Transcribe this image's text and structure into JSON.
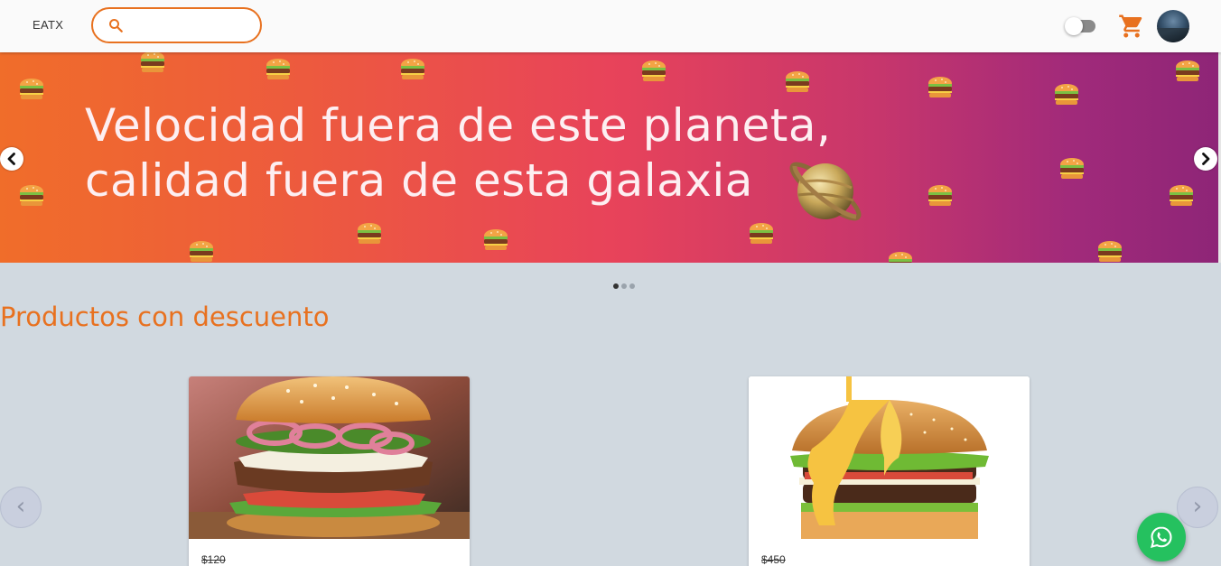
{
  "header": {
    "brand": "EATX",
    "search": {
      "value": "",
      "placeholder": ""
    },
    "dark_mode_toggle": {
      "on": false
    }
  },
  "banner": {
    "line1": "Velocidad fuera de este planeta,",
    "line2": "calidad fuera de esta galaxia",
    "slides_total": 3,
    "active_slide": 1
  },
  "section": {
    "title": "Productos con descuento"
  },
  "products": [
    {
      "name": "burger-pickled-onion",
      "old_price": "$120"
    },
    {
      "name": "burger-cheese-double",
      "old_price": "$450"
    }
  ],
  "colors": {
    "accent": "#e8711f",
    "banner_start": "#f06d2a",
    "banner_end": "#8e2577",
    "whatsapp": "#25c15f"
  },
  "icons": {
    "search": "search-icon",
    "cart": "cart-icon",
    "whatsapp": "whatsapp-icon",
    "prev": "chevron-left-icon",
    "next": "chevron-right-icon"
  }
}
